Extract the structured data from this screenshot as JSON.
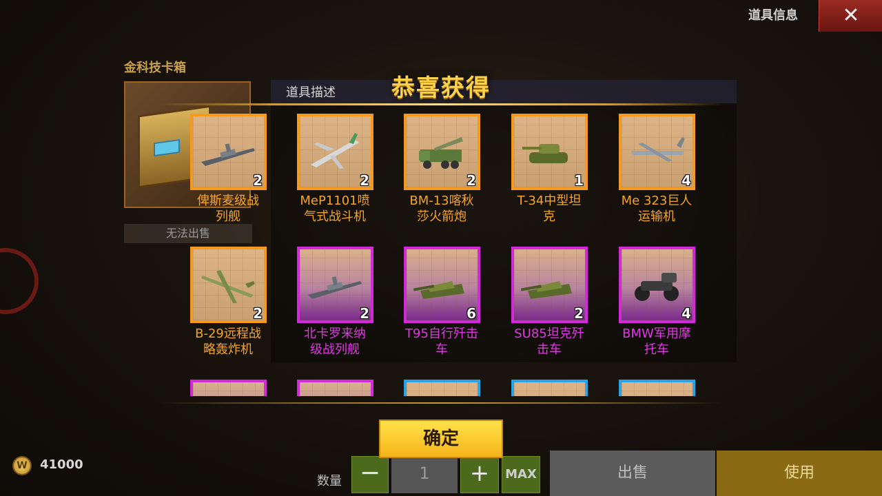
{
  "header": {
    "title": "道具信息",
    "close_icon": "close-icon"
  },
  "item": {
    "name": "金科技卡箱",
    "icon": "chest-icon",
    "no_sale_label": "无法出售"
  },
  "description": {
    "label": "道具描述"
  },
  "popup": {
    "title": "恭喜获得",
    "confirm_label": "确定",
    "rewards": [
      {
        "name": "俾斯麦级战列舰",
        "line1": "俾斯麦级战",
        "line2": "列舰",
        "qty": "2",
        "rarity": "orange",
        "icon": "battleship-icon"
      },
      {
        "name": "MeP1101喷气式战斗机",
        "line1": "MeP1101喷",
        "line2": "气式战斗机",
        "qty": "2",
        "rarity": "orange",
        "icon": "jet-fighter-icon"
      },
      {
        "name": "BM-13喀秋莎火箭炮",
        "line1": "BM-13喀秋",
        "line2": "莎火箭炮",
        "qty": "2",
        "rarity": "orange",
        "icon": "rocket-truck-icon"
      },
      {
        "name": "T-34中型坦克",
        "line1": "T-34中型坦",
        "line2": "克",
        "qty": "1",
        "rarity": "orange",
        "icon": "tank-icon"
      },
      {
        "name": "Me 323巨人运输机",
        "line1": "Me 323巨人",
        "line2": "运输机",
        "qty": "4",
        "rarity": "orange",
        "icon": "transport-plane-icon"
      },
      {
        "name": "B-29远程战略轰炸机",
        "line1": "B-29远程战",
        "line2": "略轰炸机",
        "qty": "2",
        "rarity": "orange",
        "icon": "bomber-icon"
      },
      {
        "name": "北卡罗来纳级战列舰",
        "line1": "北卡罗来纳",
        "line2": "级战列舰",
        "qty": "2",
        "rarity": "purple",
        "icon": "battleship-icon"
      },
      {
        "name": "T95自行歼击车",
        "line1": "T95自行歼击",
        "line2": "车",
        "qty": "6",
        "rarity": "purple",
        "icon": "tank-destroyer-icon"
      },
      {
        "name": "SU85坦克歼击车",
        "line1": "SU85坦克歼",
        "line2": "击车",
        "qty": "2",
        "rarity": "purple",
        "icon": "tank-destroyer-icon"
      },
      {
        "name": "BMW军用摩托车",
        "line1": "BMW军用摩",
        "line2": "托车",
        "qty": "4",
        "rarity": "purple",
        "icon": "motorcycle-icon"
      }
    ],
    "partial_row_rarities": [
      "purple",
      "purple",
      "blue",
      "blue",
      "blue"
    ]
  },
  "footer": {
    "coin_icon": "coin-icon",
    "coin_letter": "W",
    "coins": "41000",
    "qty_label": "数量",
    "minus": "−",
    "qty_value": "1",
    "plus": "+",
    "max": "MAX",
    "sell": "出售",
    "use": "使用"
  },
  "colors": {
    "orange": "#f59a1c",
    "purple": "#d22ad8",
    "blue": "#2aa2e6",
    "title_gold": "#ffd24a"
  }
}
